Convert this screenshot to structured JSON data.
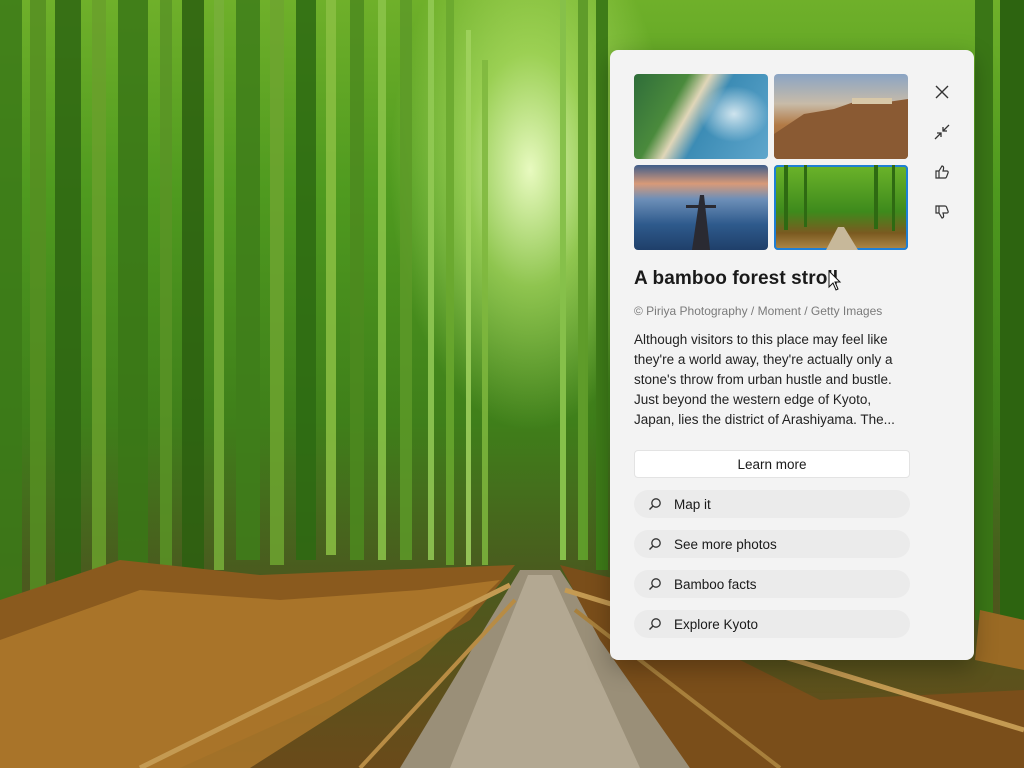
{
  "panel": {
    "title": "A bamboo forest stroll",
    "credit": "© Piriya Photography / Moment / Getty Images",
    "description": "Although visitors to this place may feel like they're a world away, they're actually only a stone's throw from urban hustle and bustle. Just beyond the western edge of Kyoto, Japan, lies the district of Arashiyama. The...",
    "learn_more_label": "Learn more",
    "searches": [
      {
        "label": "Map it",
        "icon": "search-icon"
      },
      {
        "label": "See more photos",
        "icon": "search-icon"
      },
      {
        "label": "Bamboo facts",
        "icon": "search-icon"
      },
      {
        "label": "Explore Kyoto",
        "icon": "search-icon"
      }
    ],
    "thumbnails": [
      {
        "name": "coastal-beach-thumbnail",
        "selected": false
      },
      {
        "name": "cliff-bridge-thumbnail",
        "selected": false
      },
      {
        "name": "pier-sunset-thumbnail",
        "selected": false
      },
      {
        "name": "bamboo-forest-thumbnail",
        "selected": true
      }
    ],
    "side_actions": [
      "close-icon",
      "minimize-icon",
      "thumbs-up-icon",
      "thumbs-down-icon"
    ]
  },
  "colors": {
    "panel_bg": "#f3f3f3",
    "selected_outline": "#1e7fd6"
  }
}
